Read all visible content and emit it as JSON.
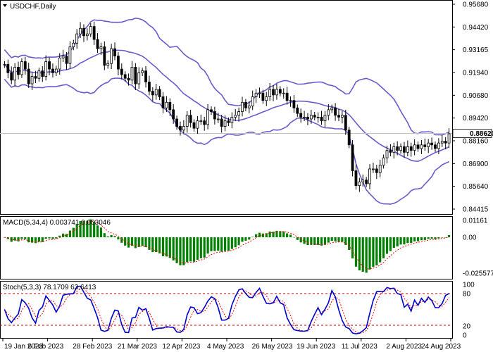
{
  "window": {
    "symbol_title": "USDCHF,Daily"
  },
  "colors": {
    "candle": "#000000",
    "bands": "#6a5acd",
    "macd_hist": "#008000",
    "macd_signal": "#ff0000",
    "stoch_main": "#0000cd",
    "stoch_signal": "#ff0000",
    "stoch_levels": "#c00000",
    "price_line": "#c0c0c0",
    "price_box": "#ffffff"
  },
  "price_panel": {
    "current_price": "0.88620",
    "ticks": [
      "0.95680",
      "0.94420",
      "0.93165",
      "0.91940",
      "0.90680",
      "0.89420",
      "0.88160",
      "0.86900",
      "0.85640",
      "0.84415"
    ]
  },
  "macd_panel": {
    "label": "MACD(5,34,4) 0.003741 0.003046",
    "ticks": [
      "0.01161",
      "0.00",
      "-0.025577"
    ]
  },
  "stoch_panel": {
    "label": "Stoch(5,3,3) 78.1709 63.6413",
    "ticks": [
      "100",
      "80",
      "20",
      "0"
    ]
  },
  "x_axis": {
    "labels": [
      "19 Jan 2023",
      "6 Feb 2023",
      "28 Feb 2023",
      "21 Mar 2023",
      "12 Apr 2023",
      "4 May 2023",
      "26 May 2023",
      "19 Jun 2023",
      "11 Jul 2023",
      "2 Aug 2023",
      "24 Aug 2023"
    ]
  },
  "chart_data": {
    "type": "candlestick",
    "title": "USDCHF,Daily",
    "close_series": [
      0.9235,
      0.919,
      0.915,
      0.922,
      0.918,
      0.925,
      0.921,
      0.913,
      0.917,
      0.916,
      0.92,
      0.917,
      0.925,
      0.921,
      0.919,
      0.921,
      0.927,
      0.928,
      0.924,
      0.933,
      0.935,
      0.94,
      0.943,
      0.939,
      0.94,
      0.944,
      0.937,
      0.932,
      0.933,
      0.923,
      0.924,
      0.932,
      0.928,
      0.921,
      0.918,
      0.916,
      0.915,
      0.922,
      0.913,
      0.919,
      0.92,
      0.914,
      0.909,
      0.907,
      0.91,
      0.906,
      0.9,
      0.903,
      0.899,
      0.894,
      0.89,
      0.888,
      0.89,
      0.896,
      0.892,
      0.889,
      0.893,
      0.893,
      0.891,
      0.899,
      0.898,
      0.894,
      0.894,
      0.89,
      0.893,
      0.892,
      0.895,
      0.896,
      0.898,
      0.903,
      0.9,
      0.901,
      0.906,
      0.908,
      0.908,
      0.904,
      0.906,
      0.91,
      0.907,
      0.91,
      0.908,
      0.908,
      0.904,
      0.904,
      0.9,
      0.897,
      0.895,
      0.895,
      0.894,
      0.896,
      0.895,
      0.895,
      0.893,
      0.896,
      0.899,
      0.9,
      0.896,
      0.895,
      0.896,
      0.888,
      0.88,
      0.866,
      0.858,
      0.86,
      0.861,
      0.859,
      0.867,
      0.867,
      0.865,
      0.869,
      0.873,
      0.877,
      0.876,
      0.879,
      0.877,
      0.879,
      0.876,
      0.879,
      0.877,
      0.88,
      0.878,
      0.88,
      0.879,
      0.881,
      0.88,
      0.878,
      0.881,
      0.882,
      0.881,
      0.886
    ]
  }
}
